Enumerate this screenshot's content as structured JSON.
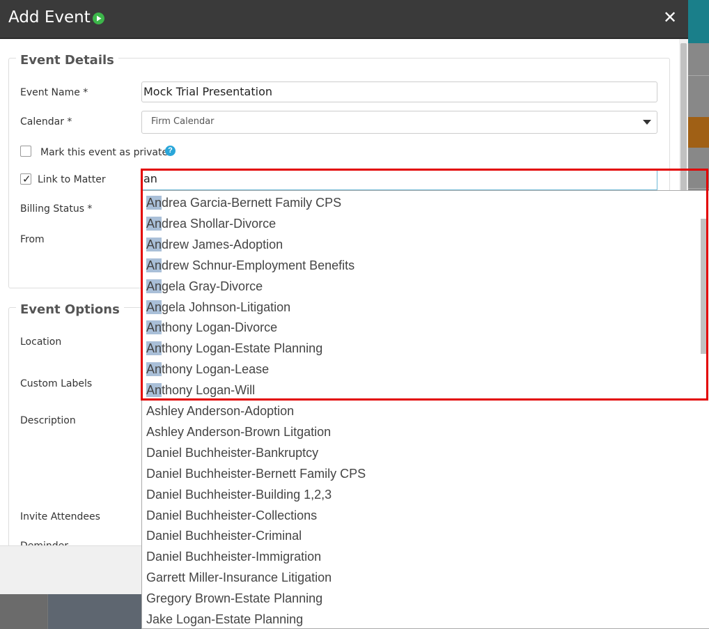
{
  "modal": {
    "title": "Add Event",
    "close_symbol": "✕"
  },
  "event_details": {
    "legend": "Event Details",
    "event_name_label": "Event Name *",
    "event_name_value": "Mock Trial Presentation",
    "calendar_label": "Calendar *",
    "calendar_value": "Firm Calendar",
    "private_label": "Mark this event as private",
    "private_checked": false,
    "help_symbol": "?",
    "link_matter_label": "Link to Matter",
    "link_matter_checked": true,
    "check_symbol": "✓",
    "billing_status_label": "Billing Status *",
    "from_label": "From"
  },
  "event_options": {
    "legend": "Event Options",
    "location_label": "Location",
    "custom_labels_label": "Custom Labels",
    "description_label": "Description",
    "invite_attendees_label": "Invite Attendees",
    "partial_label": "Deminder"
  },
  "matter_search": {
    "query": "an",
    "results": [
      {
        "match": "An",
        "rest": "drea Garcia-Bernett Family CPS"
      },
      {
        "match": "An",
        "rest": "drea Shollar-Divorce"
      },
      {
        "match": "An",
        "rest": "drew James-Adoption"
      },
      {
        "match": "An",
        "rest": "drew Schnur-Employment Benefits"
      },
      {
        "match": "An",
        "rest": "gela Gray-Divorce"
      },
      {
        "match": "An",
        "rest": "gela Johnson-Litigation"
      },
      {
        "match": "An",
        "rest": "thony Logan-Divorce"
      },
      {
        "match": "An",
        "rest": "thony Logan-Estate Planning"
      },
      {
        "match": "An",
        "rest": "thony Logan-Lease"
      },
      {
        "match": "An",
        "rest": "thony Logan-Will"
      },
      {
        "match": "",
        "rest": "Ashley Anderson-Adoption"
      },
      {
        "match": "",
        "rest": "Ashley Anderson-Brown Litgation"
      },
      {
        "match": "",
        "rest": "Daniel Buchheister-Bankruptcy"
      },
      {
        "match": "",
        "rest": "Daniel Buchheister-Bernett Family CPS"
      },
      {
        "match": "",
        "rest": "Daniel Buchheister-Building 1,2,3"
      },
      {
        "match": "",
        "rest": "Daniel Buchheister-Collections"
      },
      {
        "match": "",
        "rest": "Daniel Buchheister-Criminal"
      },
      {
        "match": "",
        "rest": "Daniel Buchheister-Immigration"
      },
      {
        "match": "",
        "rest": "Garrett Miller-Insurance Litigation"
      },
      {
        "match": "",
        "rest": "Gregory Brown-Estate Planning"
      },
      {
        "match": "",
        "rest": "Jake Logan-Estate Planning"
      }
    ]
  },
  "colors": {
    "header_bg": "#3a3a3a",
    "play_icon": "#3cb64a",
    "help_icon": "#29a6d9",
    "highlight": "#a9bfd8",
    "annotation_box": "#e30000"
  }
}
